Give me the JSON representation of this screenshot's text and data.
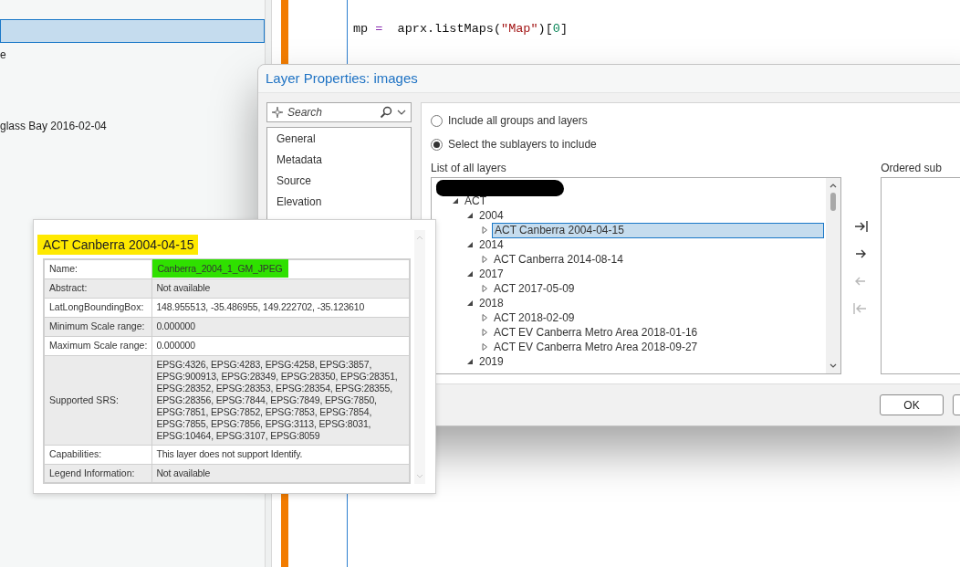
{
  "background_panel": {
    "items": [
      {
        "selected": true
      },
      {
        "label": "e",
        "selected": false
      },
      {
        "label": "glass Bay 2016-02-04",
        "selected": false
      }
    ]
  },
  "code_editor": {
    "lines": [
      {
        "tokens": [
          {
            "text": "mp",
            "kind": "plain"
          },
          {
            "text": " = ",
            "kind": "operator"
          },
          {
            "text": " aprx.listMaps(",
            "kind": "plain"
          },
          {
            "text": "\"Map\"",
            "kind": "string"
          },
          {
            "text": ")[",
            "kind": "plain"
          },
          {
            "text": "0",
            "kind": "number"
          },
          {
            "text": "]",
            "kind": "plain"
          }
        ]
      }
    ]
  },
  "dialog": {
    "title": "Layer Properties: images",
    "search": {
      "placeholder": "Search"
    },
    "nav_items": [
      {
        "label": "General",
        "selected": false
      },
      {
        "label": "Metadata",
        "selected": false
      },
      {
        "label": "Source",
        "selected": false
      },
      {
        "label": "Elevation",
        "selected": false
      }
    ],
    "options": [
      {
        "label": "Include all groups and layers",
        "selected": false
      },
      {
        "label": "Select the sublayers to include",
        "selected": true
      }
    ],
    "layers_label": "List of all layers",
    "layer_tree": [
      {
        "redacted": true,
        "children": [
          {
            "label": "ACT",
            "expanded": true,
            "children": [
              {
                "label": "2004",
                "expanded": true,
                "children": [
                  {
                    "label": "ACT Canberra 2004-04-15",
                    "expanded": false,
                    "selected": true
                  }
                ]
              },
              {
                "label": "2014",
                "expanded": true,
                "children": [
                  {
                    "label": "ACT Canberra 2014-08-14",
                    "expanded": false,
                    "selected": false
                  }
                ]
              },
              {
                "label": "2017",
                "expanded": true,
                "children": [
                  {
                    "label": "ACT 2017-05-09",
                    "expanded": false,
                    "selected": false
                  }
                ]
              },
              {
                "label": "2018",
                "expanded": true,
                "children": [
                  {
                    "label": "ACT 2018-02-09",
                    "expanded": false,
                    "selected": false
                  },
                  {
                    "label": "ACT EV Canberra Metro Area 2018-01-16",
                    "expanded": false,
                    "selected": false
                  },
                  {
                    "label": "ACT EV Canberra Metro Area 2018-09-27",
                    "expanded": false,
                    "selected": false
                  }
                ]
              },
              {
                "label": "2019",
                "expanded": true
              }
            ]
          }
        ]
      }
    ],
    "transfer_buttons": [
      {
        "kind": "add_all",
        "disabled": false
      },
      {
        "kind": "add",
        "disabled": false
      },
      {
        "kind": "remove",
        "disabled": true
      },
      {
        "kind": "remove_all",
        "disabled": true
      }
    ],
    "ordered_label": "Ordered sub",
    "buttons": [
      "OK"
    ]
  },
  "layer_info_popup": {
    "title": "ACT Canberra 2004-04-15",
    "title_highlighted": true,
    "rows": [
      {
        "label": "Name:",
        "value": "Canberra_2004_1_GM_JPEG",
        "value_highlighted": true
      },
      {
        "label": "Abstract:",
        "value": "Not available"
      },
      {
        "label": "LatLongBoundingBox:",
        "value": "148.955513, -35.486955, 149.222702, -35.123610"
      },
      {
        "label": "Minimum Scale range:",
        "value": "0.000000"
      },
      {
        "label": "Maximum Scale range:",
        "value": "0.000000"
      },
      {
        "label": "Supported SRS:",
        "value": "EPSG:4326, EPSG:4283, EPSG:4258, EPSG:3857, EPSG:900913, EPSG:28349, EPSG:28350, EPSG:28351, EPSG:28352, EPSG:28353, EPSG:28354, EPSG:28355, EPSG:28356, EPSG:7844, EPSG:7849, EPSG:7850, EPSG:7851, EPSG:7852, EPSG:7853, EPSG:7854, EPSG:7855, EPSG:7856, EPSG:3113, EPSG:8031, EPSG:10464, EPSG:3107, EPSG:8059"
      },
      {
        "label": "Capabilities:",
        "value": "This layer does not support Identify."
      },
      {
        "label": "Legend Information:",
        "value": "Not available"
      }
    ]
  }
}
